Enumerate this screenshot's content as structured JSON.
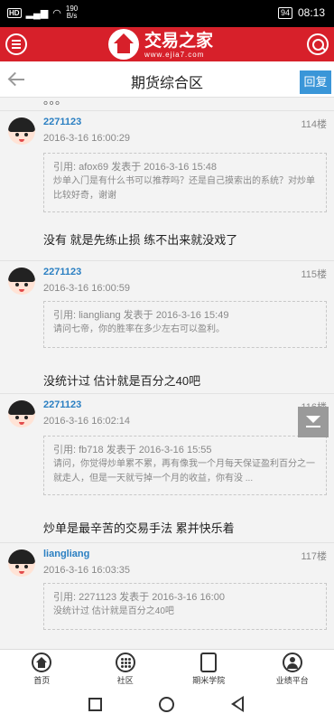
{
  "statusbar": {
    "speed_value": "190",
    "speed_unit": "B/s",
    "battery": "94",
    "time": "08:13"
  },
  "header": {
    "brand": "交易之家",
    "domain": "www.ejia7.com"
  },
  "subheader": {
    "title": "期货综合区",
    "reply_label": "回复"
  },
  "partial_top_text": "。。。",
  "posts": [
    {
      "author": "2271123",
      "floor": "114楼",
      "time": "2016-3-16 16:00:29",
      "quote_head": "引用: afox69 发表于 2016-3-16 15:48",
      "quote_body": "炒单入门是有什么书可以推荐吗？还是自己摸索出的系统？对炒单比较好奇，谢谢",
      "reply": "没有 就是先练止损 练不出来就没戏了"
    },
    {
      "author": "2271123",
      "floor": "115楼",
      "time": "2016-3-16 16:00:59",
      "quote_head": "引用: liangliang 发表于 2016-3-16 15:49",
      "quote_body": "请问七帝，你的胜率在多少左右可以盈利。",
      "reply": "没统计过  估计就是百分之40吧"
    },
    {
      "author": "2271123",
      "floor": "116楼",
      "time": "2016-3-16 16:02:14",
      "quote_head": "引用: fb718 发表于 2016-3-16 15:55",
      "quote_body": "请问，你觉得炒单累不累，再有像我一个月每天保证盈利百分之一就走人，但是一天就亏掉一个月的收益，你有没 ...",
      "reply": "炒单是最辛苦的交易手法  累并快乐着"
    },
    {
      "author": "liangliang",
      "floor": "117楼",
      "time": "2016-3-16 16:03:35",
      "quote_head": "引用: 2271123 发表于 2016-3-16 16:00",
      "quote_body": "没统计过  估计就是百分之40吧",
      "reply": ""
    }
  ],
  "bottomnav": {
    "home": "首页",
    "community": "社区",
    "academy": "期米学院",
    "platform": "业绩平台"
  }
}
